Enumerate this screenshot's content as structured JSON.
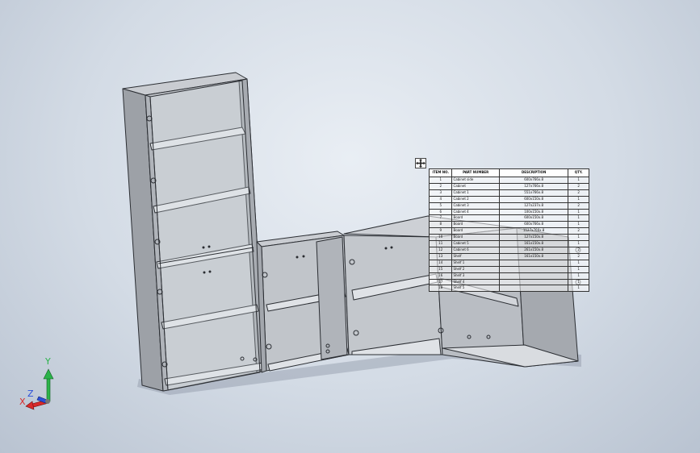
{
  "bom_table": {
    "headers": [
      "ITEM NO.",
      "PART NUMBER",
      "DESCRIPTION",
      "QTY."
    ],
    "rows": [
      [
        "1",
        "Cabinet side",
        "600x766x.8",
        "1"
      ],
      [
        "2",
        "Cabinet",
        "127x766x.8",
        "2"
      ],
      [
        "3",
        "Cabinet 1",
        "551x766x.8",
        "2"
      ],
      [
        "4",
        "Cabinet 2",
        "600x150x.8",
        "1"
      ],
      [
        "5",
        "Cabinet 3",
        "127x237x.8",
        "2"
      ],
      [
        "6",
        "Cabinet 4",
        "100x150x.8",
        "1"
      ],
      [
        "7",
        "Board",
        "600x150x.8",
        "1"
      ],
      [
        "8",
        "Board",
        "600x766x.8",
        "1"
      ],
      [
        "9",
        "Board",
        "1127x766x.8",
        "2"
      ],
      [
        "10",
        "Board",
        "127x150x.8",
        "1"
      ],
      [
        "11",
        "Cabinet 5",
        "161x150x.8",
        "1"
      ],
      [
        "12",
        "Cabinet 6",
        "261x150x.8",
        "2"
      ],
      [
        "13",
        "Shelf",
        "161x150x.8",
        "2"
      ],
      [
        "14",
        "Shelf 1",
        "",
        "1"
      ],
      [
        "15",
        "Shelf 2",
        "",
        "1"
      ],
      [
        "16",
        "Shelf 3",
        "",
        "1"
      ],
      [
        "17",
        "Shelf 4",
        "",
        "1"
      ],
      [
        "18",
        "Shelf 5",
        "",
        "1"
      ]
    ]
  },
  "triad": {
    "x_label": "X",
    "y_label": "Y",
    "z_label": "Z"
  },
  "colors": {
    "panel_face": "#d6d9dd",
    "panel_dark": "#8e9298",
    "panel_side": "#b4b8be",
    "edge": "#2b2e33",
    "axis_x": "#d92a2a",
    "axis_y": "#2bb34a",
    "axis_z": "#2a4fd9"
  }
}
